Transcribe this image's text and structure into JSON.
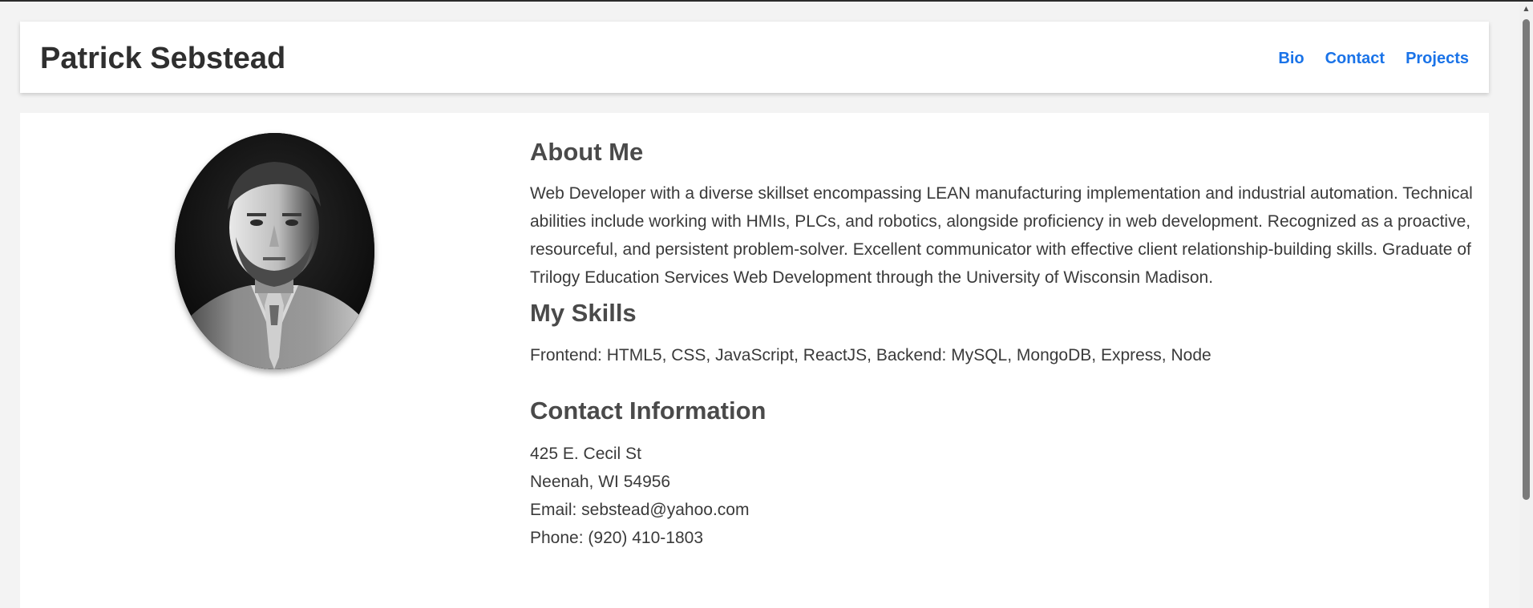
{
  "header": {
    "title": "Patrick Sebstead",
    "nav": [
      {
        "label": "Bio"
      },
      {
        "label": "Contact"
      },
      {
        "label": "Projects"
      }
    ]
  },
  "colors": {
    "nav_link": "#1a73e8",
    "page_background": "#f3f3f3",
    "card_background": "#ffffff",
    "heading_text": "#4a4a4a"
  },
  "profile": {
    "photo_icon": "portrait-photo"
  },
  "about": {
    "heading": "About Me",
    "text": "Web Developer with a diverse skillset encompassing LEAN manufacturing implementation and industrial automation. Technical abilities include working with HMIs, PLCs, and robotics, alongside proficiency in web development. Recognized as a proactive, resourceful, and persistent problem-solver. Excellent communicator with effective client relationship-building skills. Graduate of Trilogy Education Services Web Development through the University of Wisconsin Madison."
  },
  "skills": {
    "heading": "My Skills",
    "text": "Frontend: HTML5, CSS, JavaScript, ReactJS, Backend: MySQL, MongoDB, Express, Node"
  },
  "contact": {
    "heading": "Contact Information",
    "address_line1": "425 E. Cecil St",
    "address_line2": "Neenah, WI 54956",
    "email": "Email: sebstead@yahoo.com",
    "phone": "Phone: (920) 410-1803"
  }
}
